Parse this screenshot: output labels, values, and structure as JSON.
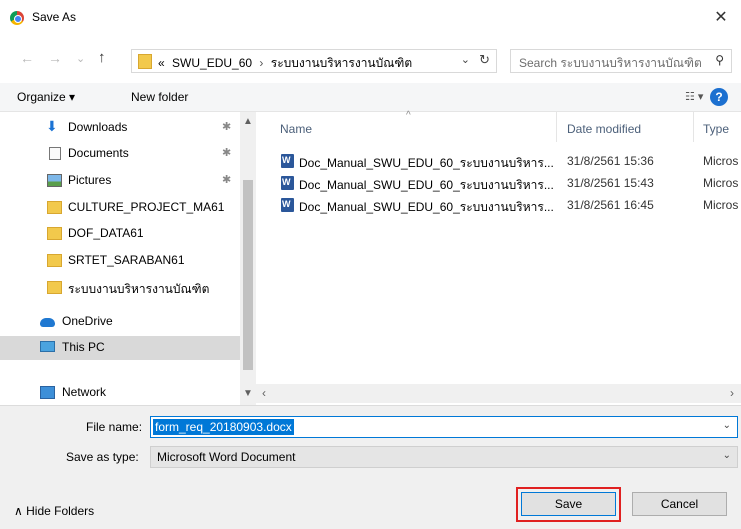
{
  "dialog": {
    "title": "Save As",
    "close_glyph": "✕"
  },
  "address": {
    "back": "←",
    "forward": "→",
    "recent": "⌄",
    "up": "↑",
    "crumbs": [
      "«",
      "SWU_EDU_60",
      "›",
      "ระบบงานบริหารงานบัณฑิต"
    ],
    "search_placeholder": "Search ระบบงานบริหารงานบัณฑิต"
  },
  "toolbar": {
    "organize": "Organize ▾",
    "new_folder": "New folder",
    "views": "☷ ▾",
    "help": "?"
  },
  "nav": {
    "items": [
      {
        "label": "Downloads",
        "icon": "download-icon",
        "pinned": true
      },
      {
        "label": "Documents",
        "icon": "document-icon",
        "pinned": true
      },
      {
        "label": "Pictures",
        "icon": "pictures-icon",
        "pinned": true
      },
      {
        "label": "CULTURE_PROJECT_MA61",
        "icon": "folder-icon",
        "pinned": false
      },
      {
        "label": "DOF_DATA61",
        "icon": "folder-icon",
        "pinned": false
      },
      {
        "label": "SRTET_SARABAN61",
        "icon": "folder-icon",
        "pinned": false
      },
      {
        "label": "ระบบงานบริหารงานบัณฑิต",
        "icon": "folder-icon",
        "pinned": false
      },
      {
        "label": "OneDrive",
        "icon": "onedrive-icon",
        "pinned": false
      },
      {
        "label": "This PC",
        "icon": "this-pc-icon",
        "pinned": false,
        "selected": true
      },
      {
        "label": "Network",
        "icon": "network-icon",
        "pinned": false
      }
    ],
    "pin_glyph": "✱"
  },
  "files": {
    "columns": {
      "name": "Name",
      "date": "Date modified",
      "type": "Type"
    },
    "rows": [
      {
        "name": "Doc_Manual_SWU_EDU_60_ระบบงานบริหาร...",
        "date": "31/8/2561 15:36",
        "type": "Micros"
      },
      {
        "name": "Doc_Manual_SWU_EDU_60_ระบบงานบริหาร...",
        "date": "31/8/2561 15:43",
        "type": "Micros"
      },
      {
        "name": "Doc_Manual_SWU_EDU_60_ระบบงานบริหาร...",
        "date": "31/8/2561 16:45",
        "type": "Micros"
      }
    ]
  },
  "form": {
    "file_name_label": "File name:",
    "file_name_value": "form_req_20180903.docx",
    "save_type_label": "Save as type:",
    "save_type_value": "Microsoft Word Document",
    "hide_folders": "∧  Hide Folders",
    "save_label": "Save",
    "cancel_label": "Cancel"
  },
  "colors": {
    "accent": "#0078d7",
    "highlight": "#e02020"
  }
}
